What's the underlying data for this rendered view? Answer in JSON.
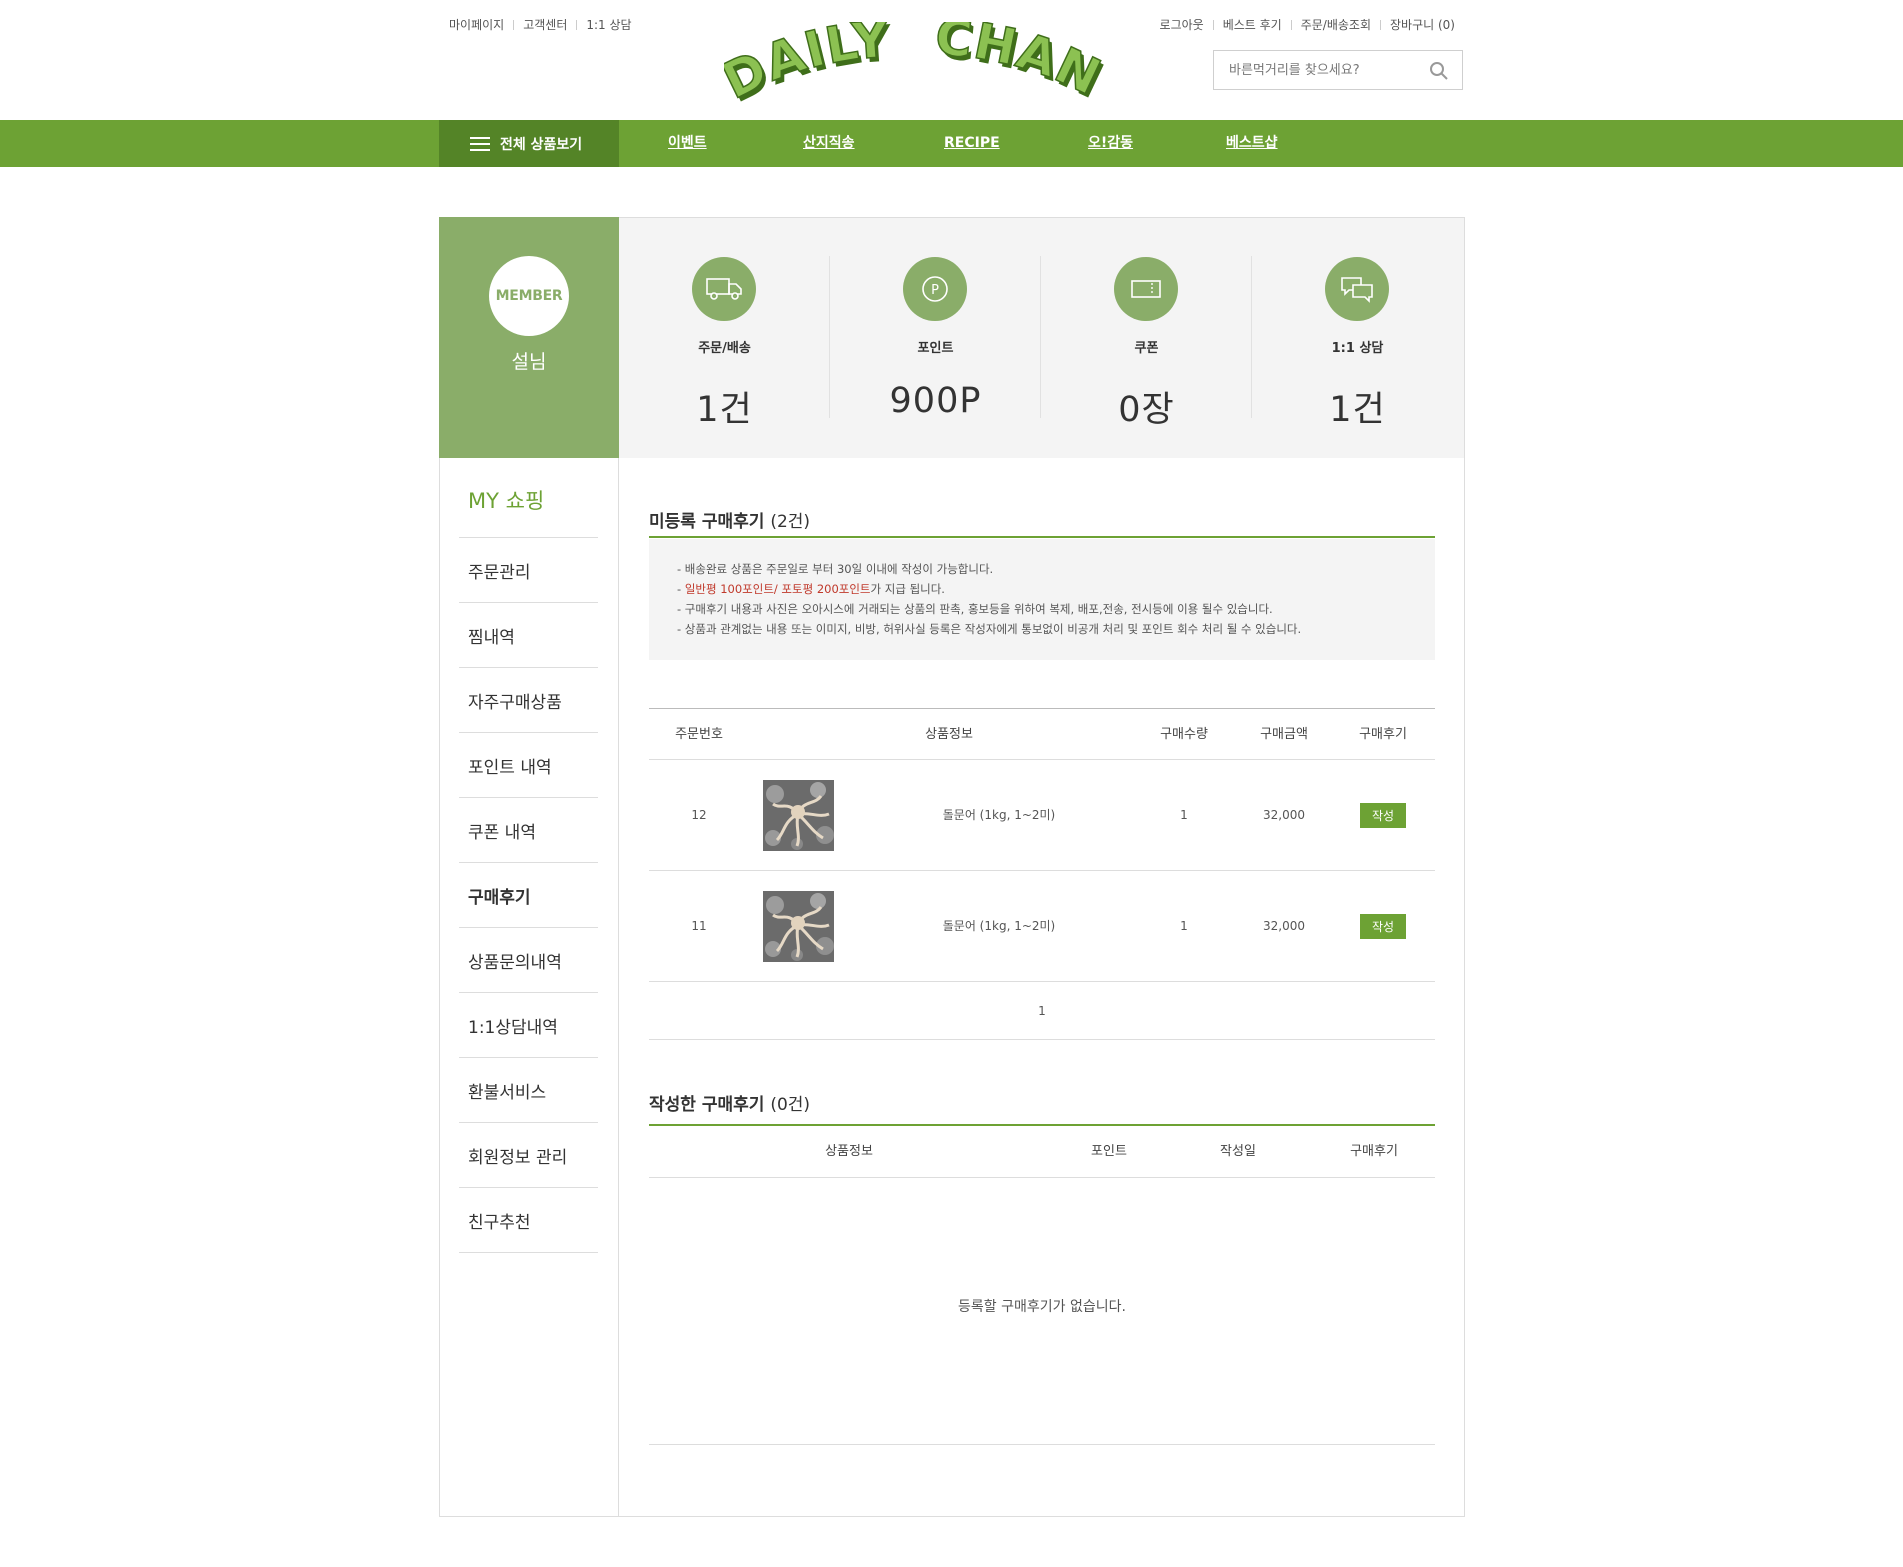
{
  "util_left": [
    "마이페이지",
    "고객센터",
    "1:1 상담"
  ],
  "util_right": [
    "로그아웃",
    "베스트 후기",
    "주문/배송조회",
    "장바구니 (0)"
  ],
  "logo": {
    "text": "DAILY CHAN",
    "color": "#6da234"
  },
  "search": {
    "placeholder": "바른먹거리를 찾으세요?",
    "icon": "search-icon"
  },
  "gnb": {
    "all_label": "전체 상품보기",
    "menu": [
      "이벤트",
      "산지직송",
      "RECIPE",
      "오!감동",
      "베스트샵"
    ]
  },
  "member": {
    "badge": "MEMBER",
    "name": "설님"
  },
  "stats": [
    {
      "label": "주문/배송",
      "value": "1건",
      "icon": "truck-icon"
    },
    {
      "label": "포인트",
      "value": "900P",
      "icon": "point-icon"
    },
    {
      "label": "쿠폰",
      "value": "0장",
      "icon": "coupon-icon"
    },
    {
      "label": "1:1 상담",
      "value": "1건",
      "icon": "chat-icon"
    }
  ],
  "side": {
    "title": "MY 쇼핑",
    "items": [
      "주문관리",
      "찜내역",
      "자주구매상품",
      "포인트 내역",
      "쿠폰 내역",
      "구매후기",
      "상품문의내역",
      "1:1상담내역",
      "환불서비스",
      "회원정보 관리",
      "친구추천"
    ],
    "active": "구매후기"
  },
  "unreg": {
    "title": "미등록 구매후기",
    "count": "(2건)",
    "notices": [
      "- 배송완료 상품은 주문일로 부터 30일 이내에 작성이 가능합니다.",
      "- ",
      "- 구매후기 내용과 사진은 오아시스에 거래되는 상품의 판촉, 홍보등을 위하여 복제, 배포,전송, 전시등에 이용 될수 있습니다.",
      "- 상품과 관계없는 내용 또는 이미지, 비방, 허위사실 등록은 작성자에게 통보없이 비공개 처리 및 포인트 회수 처리 될 수 있습니다."
    ],
    "notice_red": "일반평 100포인트/ 포토평 200포인트",
    "notice_red_tail": "가 지급 됩니다.",
    "headers": [
      "주문번호",
      "상품정보",
      "구매수량",
      "구매금액",
      "구매후기"
    ],
    "rows": [
      {
        "order_no": "12",
        "product": "돌문어 (1kg, 1~2미)",
        "qty": "1",
        "price": "32,000",
        "button": "작성"
      },
      {
        "order_no": "11",
        "product": "돌문어 (1kg, 1~2미)",
        "qty": "1",
        "price": "32,000",
        "button": "작성"
      }
    ],
    "page": "1"
  },
  "written": {
    "title": "작성한 구매후기",
    "count": "(0건)",
    "headers": [
      "상품정보",
      "포인트",
      "작성일",
      "구매후기"
    ],
    "empty": "등록할 구매후기가 없습니다."
  }
}
